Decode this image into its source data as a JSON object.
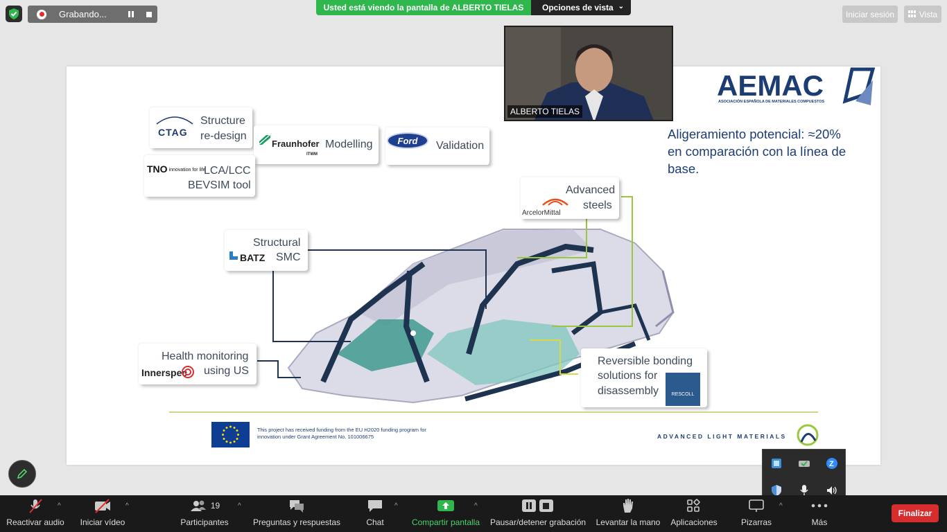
{
  "top": {
    "recording_label": "Grabando...",
    "sharing_banner": "Usted está viendo la pantalla de ALBERTO TIELAS",
    "view_options": "Opciones de vista",
    "sign_in": "Iniciar sesión",
    "view": "Vista"
  },
  "video": {
    "name": "ALBERTO TIELAS"
  },
  "slide": {
    "aemac_title": "AEMAC",
    "aemac_subtitle": "ASOCIACIÓN ESPAÑOLA DE MATERIALES COMPUESTOS",
    "lightening": "Aligeramiento potencial: ≈20% en comparación con la línea de base.",
    "cards": {
      "ctag": {
        "logo": "CTAG",
        "line1": "Structure",
        "line2": "re-design"
      },
      "fraunhofer": {
        "logo": "Fraunhofer",
        "sublogo": "ITWM",
        "text": "Modelling"
      },
      "ford": {
        "logo": "Ford",
        "text": "Validation"
      },
      "tno": {
        "logo": "TNO",
        "tagline": "innovation for life",
        "line1": "LCA/LCC",
        "line2": "BEVSIM tool"
      },
      "arcelor": {
        "logo": "ArcelorMittal",
        "line1": "Advanced",
        "line2": "steels"
      },
      "batz": {
        "logo": "BATZ",
        "line1": "Structural",
        "line2": "SMC"
      },
      "innerspec": {
        "logo": "Innerspec",
        "line1": "Health monitoring",
        "line2": "using US"
      },
      "rescoll": {
        "logo": "RESCOLL",
        "line1": "Reversible bonding",
        "line2": "solutions for",
        "line3": "disassembly"
      }
    },
    "eu_text": "This project has received funding from the EU H2020 funding program for innovation under Grant Agreement No. 101006675",
    "alm": "ADVANCED LIGHT MATERIALS"
  },
  "toolbar": {
    "audio": "Reactivar audio",
    "video": "Iniciar vídeo",
    "participants": "Participantes",
    "participants_count": "19",
    "qa": "Preguntas y respuestas",
    "chat": "Chat",
    "share": "Compartir pantalla",
    "pause_rec": "Pausar/detener grabación",
    "raise_hand": "Levantar la mano",
    "apps": "Aplicaciones",
    "whiteboards": "Pizarras",
    "more": "Más",
    "end": "Finalizar"
  },
  "colors": {
    "share_green": "#2fb64c",
    "end_red": "#d62e2e",
    "toolbar_bg": "#1a1a1a",
    "slide_navy": "#1c3d73"
  }
}
